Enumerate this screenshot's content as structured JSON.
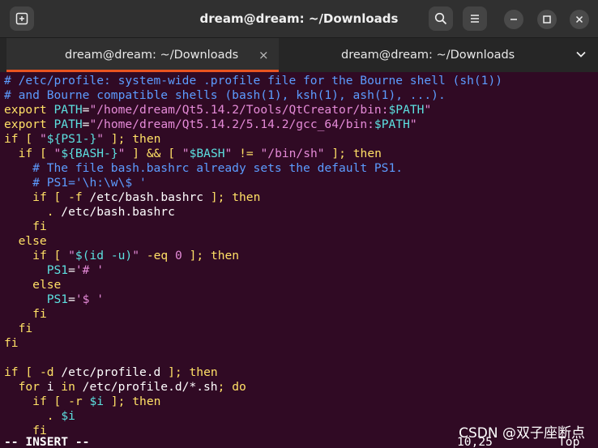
{
  "window": {
    "title": "dream@dream: ~/Downloads"
  },
  "tabs": [
    {
      "label": "dream@dream: ~/Downloads",
      "active": true
    },
    {
      "label": "dream@dream: ~/Downloads",
      "active": false
    }
  ],
  "icons": {
    "new_tab": "new-tab-icon",
    "search": "search-icon",
    "menu": "hamburger-menu-icon",
    "minimize": "minimize-icon",
    "maximize": "maximize-icon",
    "close": "close-icon",
    "tab_close": "×",
    "tab_dropdown": "chevron-down-icon"
  },
  "colors": {
    "terminal_bg": "#300a24",
    "accent": "#e95420"
  },
  "lines": [
    [
      [
        "cm",
        "# /etc/profile: system-wide .profile file for the Bourne shell (sh(1))"
      ]
    ],
    [
      [
        "cm",
        "# and Bourne compatible shells (bash(1), ksh(1), ash(1), ...)."
      ]
    ],
    [
      [
        "kw",
        "export"
      ],
      [
        "tx",
        " "
      ],
      [
        "vr",
        "PATH"
      ],
      [
        "tx",
        "="
      ],
      [
        "st",
        "\"/home/dream/Qt5.14.2/Tools/QtCreator/bin:"
      ],
      [
        "vr",
        "$PATH"
      ],
      [
        "st",
        "\""
      ]
    ],
    [
      [
        "kw",
        "export"
      ],
      [
        "tx",
        " "
      ],
      [
        "vr",
        "PATH"
      ],
      [
        "tx",
        "="
      ],
      [
        "st",
        "\"/home/dream/Qt5.14.2/5.14.2/gcc_64/bin:"
      ],
      [
        "vr",
        "$PATH"
      ],
      [
        "st",
        "\""
      ]
    ],
    [
      [
        "kw",
        "if"
      ],
      [
        "tx",
        " "
      ],
      [
        "kw",
        "["
      ],
      [
        "tx",
        " "
      ],
      [
        "st",
        "\""
      ],
      [
        "vr",
        "${PS1-}"
      ],
      [
        "st",
        "\""
      ],
      [
        "tx",
        " "
      ],
      [
        "kw",
        "];"
      ],
      [
        "tx",
        " "
      ],
      [
        "kw",
        "then"
      ]
    ],
    [
      [
        "tx",
        "  "
      ],
      [
        "kw",
        "if"
      ],
      [
        "tx",
        " "
      ],
      [
        "kw",
        "["
      ],
      [
        "tx",
        " "
      ],
      [
        "st",
        "\""
      ],
      [
        "vr",
        "${BASH-}"
      ],
      [
        "st",
        "\""
      ],
      [
        "tx",
        " "
      ],
      [
        "kw",
        "]"
      ],
      [
        "tx",
        " "
      ],
      [
        "op",
        "&&"
      ],
      [
        "tx",
        " "
      ],
      [
        "kw",
        "["
      ],
      [
        "tx",
        " "
      ],
      [
        "st",
        "\""
      ],
      [
        "vr",
        "$BASH"
      ],
      [
        "st",
        "\""
      ],
      [
        "tx",
        " "
      ],
      [
        "op",
        "!="
      ],
      [
        "tx",
        " "
      ],
      [
        "st",
        "\"/bin/sh\""
      ],
      [
        "tx",
        " "
      ],
      [
        "kw",
        "];"
      ],
      [
        "tx",
        " "
      ],
      [
        "kw",
        "then"
      ]
    ],
    [
      [
        "tx",
        "    "
      ],
      [
        "cm",
        "# The file bash.bashrc already sets the default PS1."
      ]
    ],
    [
      [
        "tx",
        "    "
      ],
      [
        "cm",
        "# PS1='\\h:\\w\\$ '"
      ]
    ],
    [
      [
        "tx",
        "    "
      ],
      [
        "kw",
        "if"
      ],
      [
        "tx",
        " "
      ],
      [
        "kw",
        "["
      ],
      [
        "tx",
        " "
      ],
      [
        "op",
        "-f"
      ],
      [
        "tx",
        " /etc/bash.bashrc "
      ],
      [
        "kw",
        "];"
      ],
      [
        "tx",
        " "
      ],
      [
        "kw",
        "then"
      ]
    ],
    [
      [
        "tx",
        "      "
      ],
      [
        "kw",
        "."
      ],
      [
        "tx",
        " /etc/bash.bashrc"
      ]
    ],
    [
      [
        "tx",
        "    "
      ],
      [
        "kw",
        "fi"
      ]
    ],
    [
      [
        "tx",
        "  "
      ],
      [
        "kw",
        "else"
      ]
    ],
    [
      [
        "tx",
        "    "
      ],
      [
        "kw",
        "if"
      ],
      [
        "tx",
        " "
      ],
      [
        "kw",
        "["
      ],
      [
        "tx",
        " "
      ],
      [
        "st",
        "\""
      ],
      [
        "vr",
        "$(id -u)"
      ],
      [
        "st",
        "\""
      ],
      [
        "tx",
        " "
      ],
      [
        "op",
        "-eq"
      ],
      [
        "tx",
        " "
      ],
      [
        "nm",
        "0"
      ],
      [
        "tx",
        " "
      ],
      [
        "kw",
        "];"
      ],
      [
        "tx",
        " "
      ],
      [
        "kw",
        "then"
      ]
    ],
    [
      [
        "tx",
        "      "
      ],
      [
        "vr",
        "PS1"
      ],
      [
        "tx",
        "="
      ],
      [
        "st",
        "'# '"
      ]
    ],
    [
      [
        "tx",
        "    "
      ],
      [
        "kw",
        "else"
      ]
    ],
    [
      [
        "tx",
        "      "
      ],
      [
        "vr",
        "PS1"
      ],
      [
        "tx",
        "="
      ],
      [
        "st",
        "'$ '"
      ]
    ],
    [
      [
        "tx",
        "    "
      ],
      [
        "kw",
        "fi"
      ]
    ],
    [
      [
        "tx",
        "  "
      ],
      [
        "kw",
        "fi"
      ]
    ],
    [
      [
        "kw",
        "fi"
      ]
    ],
    [
      [
        "tx",
        ""
      ]
    ],
    [
      [
        "kw",
        "if"
      ],
      [
        "tx",
        " "
      ],
      [
        "kw",
        "["
      ],
      [
        "tx",
        " "
      ],
      [
        "op",
        "-d"
      ],
      [
        "tx",
        " /etc/profile.d "
      ],
      [
        "kw",
        "];"
      ],
      [
        "tx",
        " "
      ],
      [
        "kw",
        "then"
      ]
    ],
    [
      [
        "tx",
        "  "
      ],
      [
        "kw",
        "for"
      ],
      [
        "tx",
        " i "
      ],
      [
        "kw",
        "in"
      ],
      [
        "tx",
        " /etc/profile.d/*.sh"
      ],
      [
        "kw",
        ";"
      ],
      [
        "tx",
        " "
      ],
      [
        "kw",
        "do"
      ]
    ],
    [
      [
        "tx",
        "    "
      ],
      [
        "kw",
        "if"
      ],
      [
        "tx",
        " "
      ],
      [
        "kw",
        "["
      ],
      [
        "tx",
        " "
      ],
      [
        "op",
        "-r"
      ],
      [
        "tx",
        " "
      ],
      [
        "vr",
        "$i"
      ],
      [
        "tx",
        " "
      ],
      [
        "kw",
        "];"
      ],
      [
        "tx",
        " "
      ],
      [
        "kw",
        "then"
      ]
    ],
    [
      [
        "tx",
        "      "
      ],
      [
        "kw",
        "."
      ],
      [
        "tx",
        " "
      ],
      [
        "vr",
        "$i"
      ]
    ],
    [
      [
        "tx",
        "    "
      ],
      [
        "kw",
        "fi"
      ]
    ]
  ],
  "status": {
    "mode": "-- INSERT --",
    "position": "10,25",
    "scroll": "Top"
  },
  "watermark": "CSDN @双子座断点"
}
